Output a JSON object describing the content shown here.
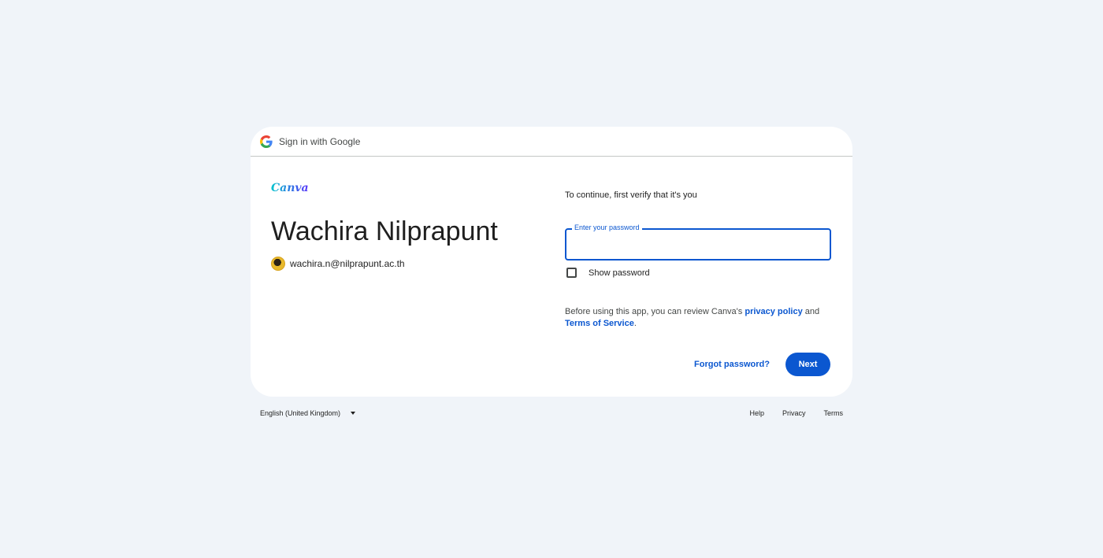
{
  "header": {
    "title": "Sign in with Google",
    "icon": "google-g-icon"
  },
  "brand": {
    "logo_text": "Canva"
  },
  "account": {
    "name": "Wachira Nilprapunt",
    "email": "wachira.n@nilprapunt.ac.th"
  },
  "form": {
    "verify_text": "To continue, first verify that it's you",
    "password_label": "Enter your password",
    "password_value": "",
    "show_password_label": "Show password",
    "show_password_checked": false
  },
  "policy": {
    "prefix": "Before using this app, you can review Canva's ",
    "privacy_link": "privacy policy",
    "middle": " and ",
    "terms_link": "Terms of Service",
    "suffix": "."
  },
  "actions": {
    "forgot_password": "Forgot password?",
    "next": "Next"
  },
  "footer": {
    "language": "English (United Kingdom)",
    "links": [
      "Help",
      "Privacy",
      "Terms"
    ]
  },
  "colors": {
    "accent": "#0b57d0",
    "background": "#f0f4f9",
    "card": "#ffffff"
  }
}
